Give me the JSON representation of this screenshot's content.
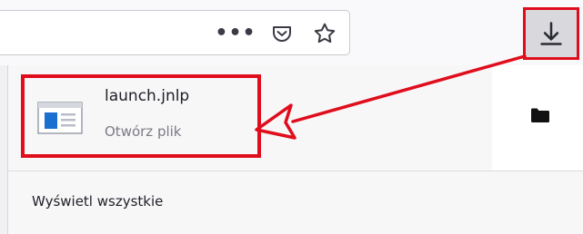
{
  "toolbar": {
    "more_actions_label": "•••",
    "icons": [
      "more-actions-icon",
      "pocket-icon",
      "bookmark-star-icon",
      "download-icon"
    ]
  },
  "downloads": {
    "items": [
      {
        "file_name": "launch.jnlp",
        "status": "Otwórz plik",
        "icon": "file-window-icon"
      }
    ],
    "show_all_label": "Wyświetl wszystkie",
    "folder_icon": "folder-icon"
  },
  "annotation": {
    "color": "#e00d1d"
  }
}
